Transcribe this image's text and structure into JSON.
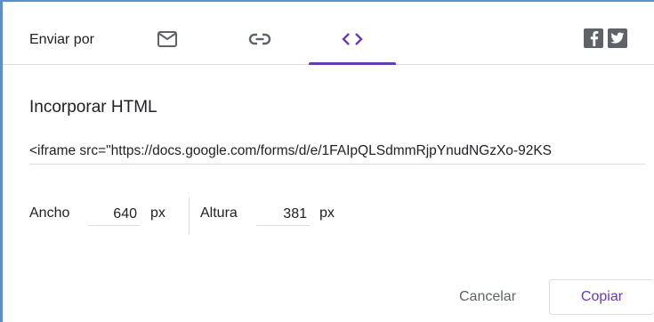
{
  "header": {
    "send_via_label": "Enviar por",
    "tabs": [
      {
        "id": "email",
        "icon": "email-icon"
      },
      {
        "id": "link",
        "icon": "link-icon"
      },
      {
        "id": "embed",
        "icon": "code-icon",
        "selected": true
      }
    ],
    "social": [
      {
        "id": "facebook",
        "icon": "facebook-icon"
      },
      {
        "id": "twitter",
        "icon": "twitter-icon"
      }
    ]
  },
  "embed": {
    "title": "Incorporar HTML",
    "code": "<iframe src=\"https://docs.google.com/forms/d/e/1FAIpQLSdmmRjpYnudNGzXo-92KS"
  },
  "dimensions": {
    "width_label": "Ancho",
    "width_value": "640",
    "width_unit": "px",
    "height_label": "Altura",
    "height_value": "381",
    "height_unit": "px"
  },
  "actions": {
    "cancel_label": "Cancelar",
    "copy_label": "Copiar"
  },
  "colors": {
    "accent": "#673ab7",
    "icon_grey": "#5f6368",
    "divider": "#dadce0",
    "frame_border": "#5b8fc7"
  }
}
